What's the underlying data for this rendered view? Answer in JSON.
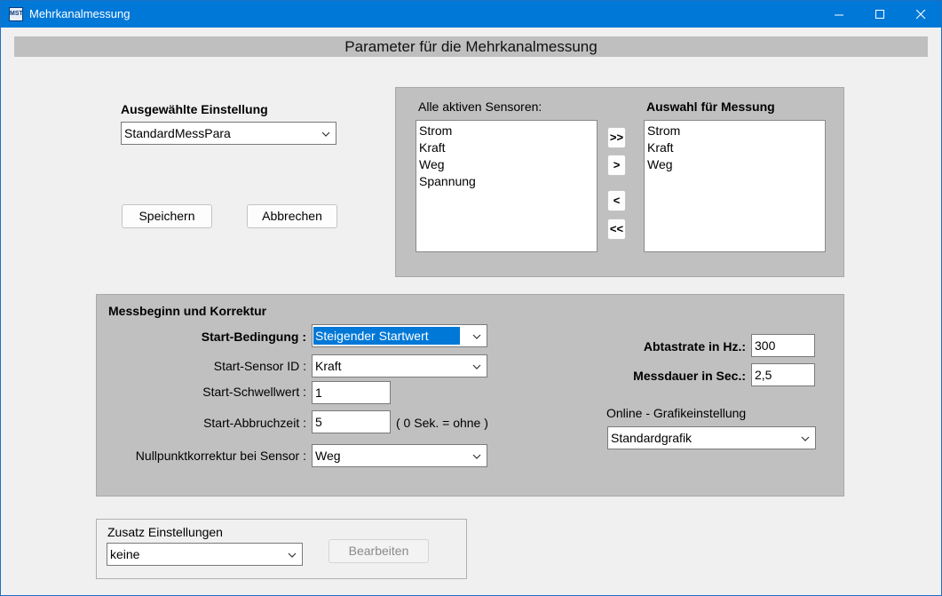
{
  "window": {
    "app_icon_text": "MST",
    "title": "Mehrkanalmessung"
  },
  "header": {
    "title": "Parameter für die Mehrkanalmessung"
  },
  "settings": {
    "label": "Ausgewählte Einstellung",
    "selected": "StandardMessPara",
    "save_label": "Speichern",
    "cancel_label": "Abbrechen"
  },
  "sensors": {
    "active_label": "Alle aktiven Sensoren:",
    "active_items": [
      "Strom",
      "Kraft",
      "Weg",
      "Spannung"
    ],
    "selected_label": "Auswahl für Messung",
    "selected_items": [
      "Strom",
      "Kraft",
      "Weg"
    ],
    "add_all_label": ">>",
    "add_label": ">",
    "remove_label": "<",
    "remove_all_label": "<<"
  },
  "start": {
    "group_title": "Messbeginn und Korrektur",
    "condition_label": "Start-Bedingung :",
    "condition_value": "Steigender Startwert",
    "sensor_label": "Start-Sensor ID :",
    "sensor_value": "Kraft",
    "threshold_label": "Start-Schwellwert :",
    "threshold_value": "1",
    "abort_label": "Start-Abbruchzeit :",
    "abort_value": "5",
    "abort_hint": "( 0 Sek. = ohne )",
    "zero_label": "Nullpunktkorrektur  bei Sensor :",
    "zero_value": "Weg",
    "rate_label": "Abtastrate in Hz.:",
    "rate_value": "300",
    "duration_label": "Messdauer in Sec.:",
    "duration_value": "2,5",
    "graphics_label": "Online - Grafikeinstellung",
    "graphics_value": "Standardgrafik"
  },
  "extra": {
    "label": "Zusatz Einstellungen",
    "value": "keine",
    "edit_label": "Bearbeiten"
  }
}
